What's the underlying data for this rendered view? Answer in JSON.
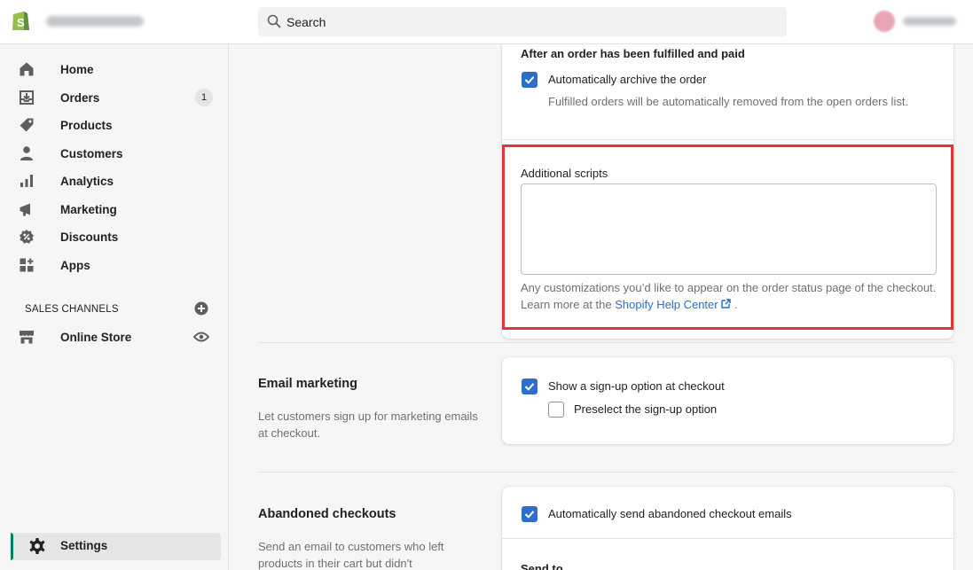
{
  "topbar": {
    "search_placeholder": "Search"
  },
  "sidebar": {
    "items": [
      {
        "label": "Home"
      },
      {
        "label": "Orders",
        "badge": "1"
      },
      {
        "label": "Products"
      },
      {
        "label": "Customers"
      },
      {
        "label": "Analytics"
      },
      {
        "label": "Marketing"
      },
      {
        "label": "Discounts"
      },
      {
        "label": "Apps"
      }
    ],
    "sales_channels_label": "SALES CHANNELS",
    "online_store_label": "Online Store",
    "settings_label": "Settings"
  },
  "order_processing": {
    "fulfilled_heading": "After an order has been fulfilled and paid",
    "archive_label": "Automatically archive the order",
    "archive_help": "Fulfilled orders will be automatically removed from the open orders list.",
    "archive_checked": true,
    "scripts_label": "Additional scripts",
    "scripts_value": "",
    "scripts_help": "Any customizations you’d like to appear on the order status page of the checkout. Learn more at the",
    "scripts_link": "Shopify Help Center",
    "scripts_help_end": "."
  },
  "email_marketing": {
    "title": "Email marketing",
    "description": "Let customers sign up for marketing emails at checkout.",
    "signup_label": "Show a sign-up option at checkout",
    "signup_checked": true,
    "preselect_label": "Preselect the sign-up option",
    "preselect_checked": false
  },
  "abandoned_checkouts": {
    "title": "Abandoned checkouts",
    "description": "Send an email to customers who left products in their cart but didn't",
    "auto_send_label": "Automatically send abandoned checkout emails",
    "auto_send_checked": true,
    "send_to_label": "Send to"
  },
  "colors": {
    "highlight": "#e0353b",
    "accent": "#2c6ecb",
    "settings_indicator": "#008060"
  }
}
